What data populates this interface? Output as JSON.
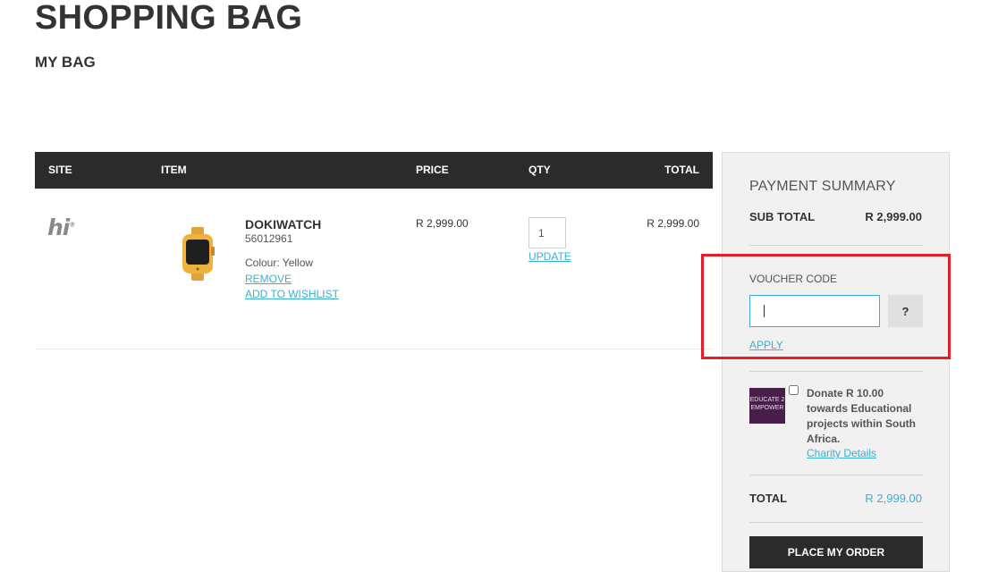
{
  "page": {
    "title": "SHOPPING BAG",
    "section": "MY BAG"
  },
  "table": {
    "headers": {
      "site": "SITE",
      "item": "ITEM",
      "price": "PRICE",
      "qty": "QTY",
      "total": "TOTAL"
    },
    "row": {
      "site_logo": "hi",
      "site_logo_mark": "®",
      "product_name": "DOKIWATCH",
      "sku": "56012961",
      "colour": "Colour: Yellow",
      "remove_label": "REMOVE",
      "wishlist_label": "ADD TO WISHLIST",
      "price": "R 2,999.00",
      "qty": "1",
      "update_label": "UPDATE",
      "total": "R 2,999.00"
    }
  },
  "summary": {
    "heading": "PAYMENT SUMMARY",
    "subtotal_label": "SUB TOTAL",
    "subtotal_value": "R 2,999.00",
    "voucher_label": "VOUCHER CODE",
    "voucher_value": "",
    "help_label": "?",
    "apply_label": "APPLY",
    "charity_logo": "EDUCATE 2 EMPOWER",
    "donate_text": "Donate R 10.00 towards Educational projects within South Africa.",
    "charity_link": "Charity Details",
    "total_label": "TOTAL",
    "total_value": "R 2,999.00",
    "place_order_label": "PLACE MY ORDER"
  },
  "colors": {
    "accent": "#3ab0cf",
    "dark": "#2b2b2b",
    "highlight": "#e41e26",
    "charity": "#4a1e4a"
  }
}
